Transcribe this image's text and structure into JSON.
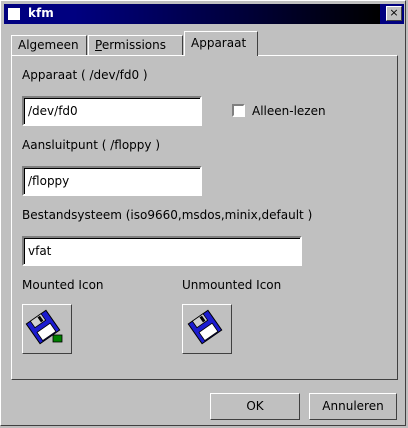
{
  "window": {
    "title": "kfm",
    "close_glyph": "×"
  },
  "tabs": [
    {
      "label": "Algemeen",
      "active": false
    },
    {
      "label": "Permissions",
      "active": false
    },
    {
      "label": "Apparaat",
      "active": true
    }
  ],
  "device": {
    "label": "Apparaat ( /dev/fd0 )",
    "value": "/dev/fd0",
    "readonly_label": "Alleen-lezen",
    "readonly_checked": false
  },
  "mountpoint": {
    "label": "Aansluitpunt ( /floppy )",
    "value": "/floppy"
  },
  "filesystem": {
    "label": "Bestandsysteem (iso9660,msdos,minix,default )",
    "value": "vfat"
  },
  "icons": {
    "mounted_label": "Mounted Icon",
    "unmounted_label": "Unmounted Icon",
    "mounted_icon": "floppy-mounted-icon",
    "unmounted_icon": "floppy-icon"
  },
  "buttons": {
    "ok": "OK",
    "cancel": "Annuleren"
  },
  "colors": {
    "titlebar": "#000080",
    "face": "#c0c0c0",
    "floppy": "#1c1cd0",
    "mounted_led": "#008000"
  }
}
